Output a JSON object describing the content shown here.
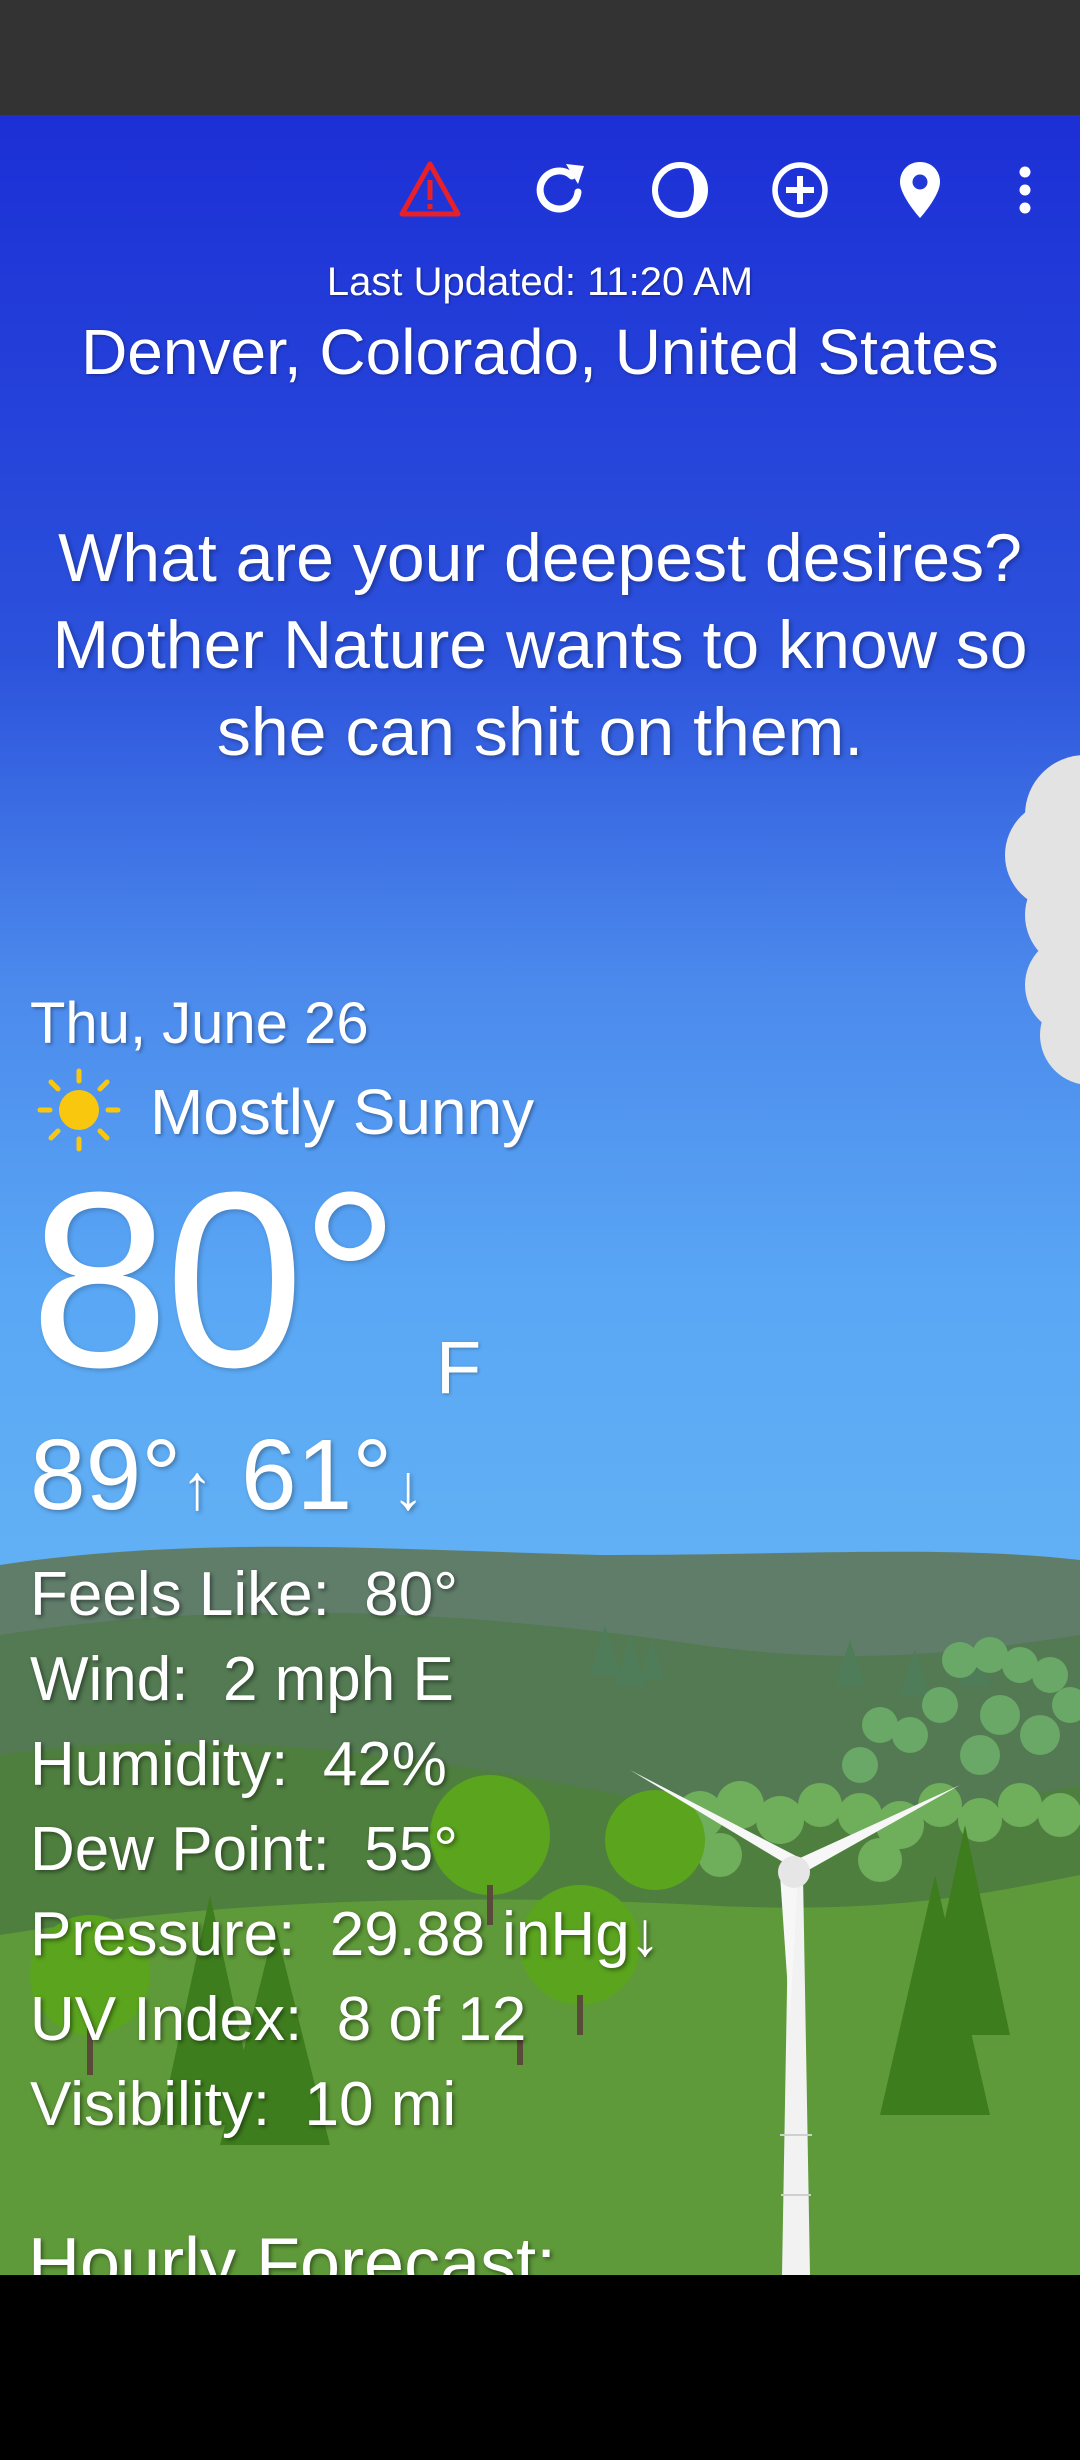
{
  "toolbar": {
    "icons": [
      "alert-icon",
      "refresh-icon",
      "theme-icon",
      "add-location-icon",
      "location-pin-icon",
      "more-icon"
    ]
  },
  "header": {
    "last_updated": "Last Updated: 11:20 AM",
    "location": "Denver, Colorado, United States"
  },
  "quote": "What are your deepest desires? Mother Nature wants to know so she can shit on them.",
  "current": {
    "date": "Thu, June 26",
    "condition": "Mostly Sunny",
    "condition_icon": "sun-icon",
    "temperature": "80°",
    "unit": "F",
    "high": "89°",
    "high_arrow": "↑",
    "low": "61°",
    "low_arrow": "↓"
  },
  "details": [
    {
      "label": "Feels Like:",
      "value": "80°"
    },
    {
      "label": "Wind:",
      "value": "2 mph E"
    },
    {
      "label": "Humidity:",
      "value": "42%"
    },
    {
      "label": "Dew Point:",
      "value": "55°"
    },
    {
      "label": "Pressure:",
      "value": "29.88 inHg↓"
    },
    {
      "label": "UV Index:",
      "value": "8 of 12"
    },
    {
      "label": "Visibility:",
      "value": "10 mi"
    }
  ],
  "hourly_title": "Hourly Forecast:",
  "colors": {
    "sky_top": "#1c2fd6",
    "sky_bottom": "#6cb8f0",
    "alert": "#e8202a",
    "sun": "#f9c80e",
    "grass": "#5f9a3a"
  }
}
